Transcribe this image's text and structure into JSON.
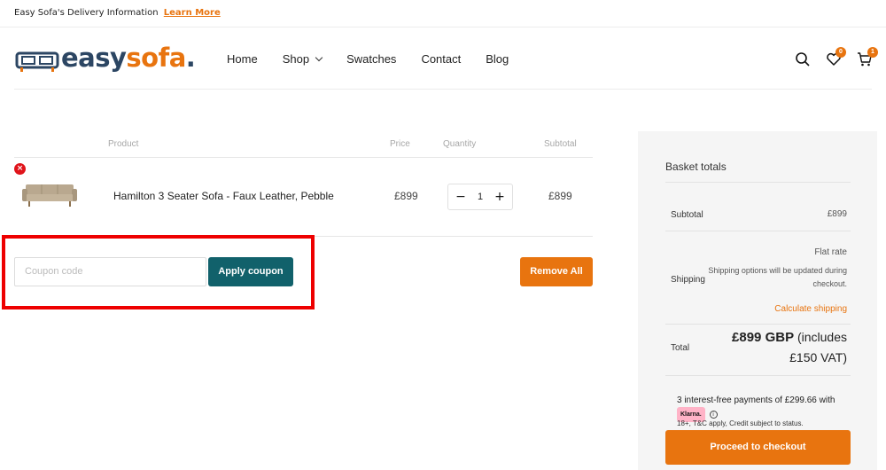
{
  "topbar": {
    "text": "Easy Sofa's Delivery Information",
    "link": "Learn More"
  },
  "logo": {
    "part1": "easy",
    "part2": "sofa",
    "dot": "."
  },
  "nav": [
    {
      "label": "Home",
      "has_dropdown": false
    },
    {
      "label": "Shop",
      "has_dropdown": true
    },
    {
      "label": "Swatches",
      "has_dropdown": false
    },
    {
      "label": "Contact",
      "has_dropdown": false
    },
    {
      "label": "Blog",
      "has_dropdown": false
    }
  ],
  "header_icons": {
    "search": "search-icon",
    "wishlist": "heart-icon",
    "wishlist_count": "0",
    "cart": "cart-icon",
    "cart_count": "1"
  },
  "cart": {
    "headers": {
      "product": "Product",
      "price": "Price",
      "quantity": "Quantity",
      "subtotal": "Subtotal"
    },
    "items": [
      {
        "name": "Hamilton 3 Seater Sofa - Faux Leather, Pebble",
        "price": "£899",
        "quantity": "1",
        "subtotal": "£899",
        "remove": "×"
      }
    ],
    "qty_minus": "−",
    "qty_plus": "+"
  },
  "coupon": {
    "placeholder": "Coupon code",
    "apply_label": "Apply coupon"
  },
  "remove_all_label": "Remove All",
  "totals": {
    "title": "Basket totals",
    "subtotal_label": "Subtotal",
    "subtotal_value": "£899",
    "shipping_label": "Shipping",
    "shipping_method": "Flat rate",
    "shipping_note": "Shipping options will be updated during checkout.",
    "calculate_shipping": "Calculate shipping",
    "total_label": "Total",
    "total_value": "£899 GBP",
    "total_suffix": " (includes £150 VAT)"
  },
  "klarna": {
    "text": "3 interest-free payments of £299.66 with",
    "badge": "Klarna.",
    "info": "i",
    "small": "18+, T&C apply, Credit subject to status."
  },
  "checkout_label": "Proceed to checkout",
  "colors": {
    "accent": "#e8740f",
    "teal": "#11616b",
    "navy": "#2c4663",
    "highlight": "#ee0000"
  }
}
